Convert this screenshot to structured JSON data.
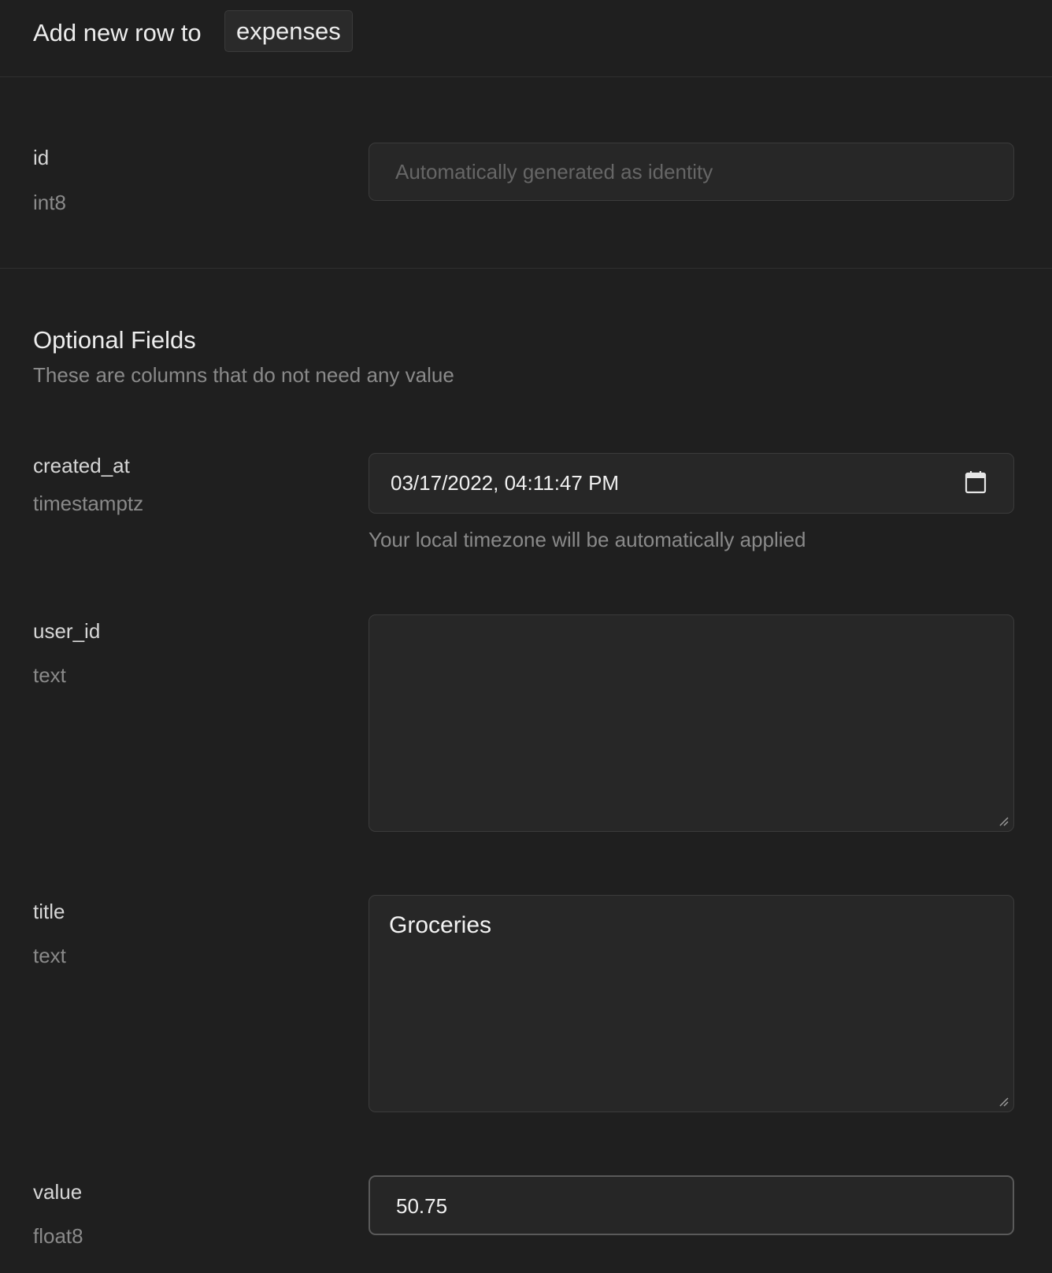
{
  "header": {
    "prefix": "Add new row to",
    "table_name": "expenses"
  },
  "fields": {
    "id": {
      "name": "id",
      "type": "int8",
      "placeholder": "Automatically generated as identity"
    },
    "created_at": {
      "name": "created_at",
      "type": "timestamptz",
      "value": "03/17/2022, 04:11:47 PM",
      "helper": "Your local timezone will be automatically applied"
    },
    "user_id": {
      "name": "user_id",
      "type": "text",
      "value": ""
    },
    "title": {
      "name": "title",
      "type": "text",
      "value": "Groceries"
    },
    "value": {
      "name": "value",
      "type": "float8",
      "value": "50.75"
    }
  },
  "optional_section": {
    "title": "Optional Fields",
    "subtitle": "These are columns that do not need any value"
  },
  "icons": {
    "date_picker": "calendar-icon",
    "resize": "resize-grip-icon"
  },
  "colors": {
    "background": "#1f1f1f",
    "input_background": "#272727",
    "border": "#3b3b3b",
    "text_primary": "#ededed",
    "text_muted": "#8a8a8a"
  }
}
